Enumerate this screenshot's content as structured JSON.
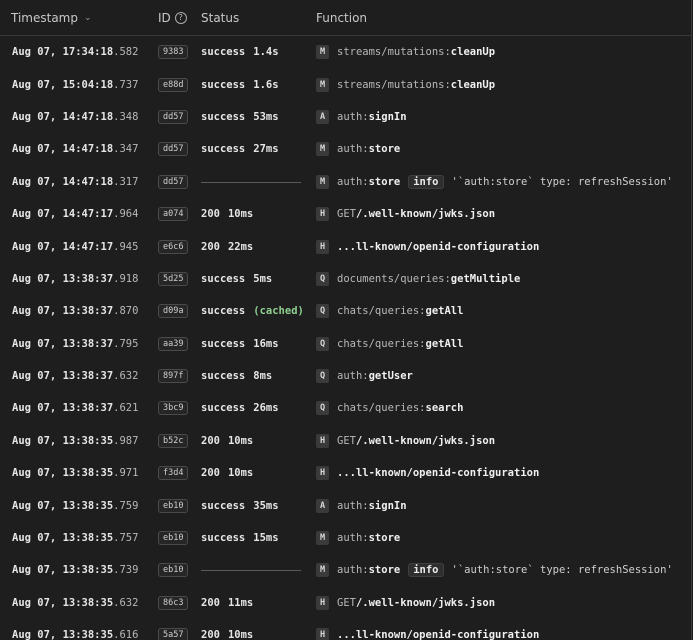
{
  "header": {
    "timestamp": "Timestamp",
    "id": "ID",
    "id_help": "?",
    "status": "Status",
    "function": "Function"
  },
  "rows": [
    {
      "date": "Aug 07, 17:34:18",
      "ms": ".582",
      "id": "9383",
      "status": "success",
      "duration": "1.4s",
      "type": "M",
      "mod": "streams/mutations:",
      "fn": "cleanUp"
    },
    {
      "date": "Aug 07, 15:04:18",
      "ms": ".737",
      "id": "e88d",
      "status": "success",
      "duration": "1.6s",
      "type": "M",
      "mod": "streams/mutations:",
      "fn": "cleanUp"
    },
    {
      "date": "Aug 07, 14:47:18",
      "ms": ".348",
      "id": "dd57",
      "status": "success",
      "duration": "53ms",
      "type": "A",
      "mod": "auth:",
      "fn": "signIn"
    },
    {
      "date": "Aug 07, 14:47:18",
      "ms": ".347",
      "id": "dd57",
      "status": "success",
      "duration": "27ms",
      "type": "M",
      "mod": "auth:",
      "fn": "store"
    },
    {
      "date": "Aug 07, 14:47:18",
      "ms": ".317",
      "id": "dd57",
      "log": true,
      "type": "M",
      "mod": "auth:",
      "fn": "store",
      "level": "info",
      "message": "'`auth:store` type: refreshSession'"
    },
    {
      "date": "Aug 07, 14:47:17",
      "ms": ".964",
      "id": "a074",
      "status": "200",
      "duration": "10ms",
      "type": "H",
      "mod": "GET ",
      "fn": "/.well-known/jwks.json"
    },
    {
      "date": "Aug 07, 14:47:17",
      "ms": ".945",
      "id": "e6c6",
      "status": "200",
      "duration": "22ms",
      "type": "H",
      "mod": "",
      "fn": "...ll-known/openid-configuration"
    },
    {
      "date": "Aug 07, 13:38:37",
      "ms": ".918",
      "id": "5d25",
      "status": "success",
      "duration": " 5ms",
      "type": "Q",
      "mod": "documents/queries:",
      "fn": "getMultiple"
    },
    {
      "date": "Aug 07, 13:38:37",
      "ms": ".870",
      "id": "d09a",
      "status": "success",
      "cached": "(cached)",
      "type": "Q",
      "mod": "chats/queries:",
      "fn": "getAll"
    },
    {
      "date": "Aug 07, 13:38:37",
      "ms": ".795",
      "id": "aa39",
      "status": "success",
      "duration": "16ms",
      "type": "Q",
      "mod": "chats/queries:",
      "fn": "getAll"
    },
    {
      "date": "Aug 07, 13:38:37",
      "ms": ".632",
      "id": "897f",
      "status": "success",
      "duration": " 8ms",
      "type": "Q",
      "mod": "auth:",
      "fn": "getUser"
    },
    {
      "date": "Aug 07, 13:38:37",
      "ms": ".621",
      "id": "3bc9",
      "status": "success",
      "duration": "26ms",
      "type": "Q",
      "mod": "chats/queries:",
      "fn": "search"
    },
    {
      "date": "Aug 07, 13:38:35",
      "ms": ".987",
      "id": "b52c",
      "status": "200",
      "duration": "10ms",
      "type": "H",
      "mod": "GET ",
      "fn": "/.well-known/jwks.json"
    },
    {
      "date": "Aug 07, 13:38:35",
      "ms": ".971",
      "id": "f3d4",
      "status": "200",
      "duration": "10ms",
      "type": "H",
      "mod": "",
      "fn": "...ll-known/openid-configuration"
    },
    {
      "date": "Aug 07, 13:38:35",
      "ms": ".759",
      "id": "eb10",
      "status": "success",
      "duration": "35ms",
      "type": "A",
      "mod": "auth:",
      "fn": "signIn"
    },
    {
      "date": "Aug 07, 13:38:35",
      "ms": ".757",
      "id": "eb10",
      "status": "success",
      "duration": "15ms",
      "type": "M",
      "mod": "auth:",
      "fn": "store"
    },
    {
      "date": "Aug 07, 13:38:35",
      "ms": ".739",
      "id": "eb10",
      "log": true,
      "type": "M",
      "mod": "auth:",
      "fn": "store",
      "level": "info",
      "message": "'`auth:store` type: refreshSession'"
    },
    {
      "date": "Aug 07, 13:38:35",
      "ms": ".632",
      "id": "86c3",
      "status": "200",
      "duration": "11ms",
      "type": "H",
      "mod": "GET ",
      "fn": "/.well-known/jwks.json"
    },
    {
      "date": "Aug 07, 13:38:35",
      "ms": ".616",
      "id": "5a57",
      "status": "200",
      "duration": "10ms",
      "type": "H",
      "mod": "",
      "fn": "...ll-known/openid-configuration"
    }
  ]
}
